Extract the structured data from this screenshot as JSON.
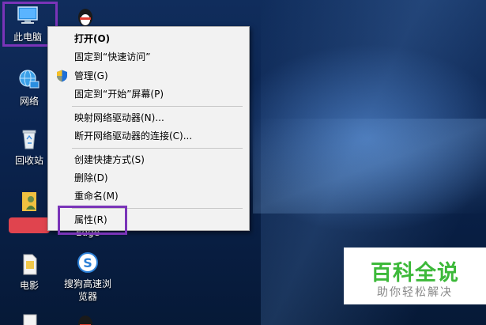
{
  "desktop_icons": [
    {
      "label": "此电脑",
      "icon": "computer-icon"
    },
    {
      "label": "网络",
      "icon": "network-icon"
    },
    {
      "label": "回收站",
      "icon": "recycle-bin-icon"
    },
    {
      "label": "",
      "icon": "user-folder-icon"
    },
    {
      "label": "电影",
      "icon": "file-icon"
    },
    {
      "label": "",
      "icon": "qq-icon"
    },
    {
      "label": "搜狗高速浏览器",
      "icon": "sogou-browser-icon"
    },
    {
      "label": "Edge",
      "icon": "edge-icon"
    }
  ],
  "context_menu": {
    "items": [
      {
        "label": "打开(O)",
        "bold": true
      },
      {
        "label": "固定到“快速访问”"
      },
      {
        "label": "管理(G)",
        "icon": "shield-icon"
      },
      {
        "label": "固定到“开始”屏幕(P)"
      },
      {
        "label": "映射网络驱动器(N)..."
      },
      {
        "label": "断开网络驱动器的连接(C)..."
      },
      {
        "label": "创建快捷方式(S)"
      },
      {
        "label": "删除(D)"
      },
      {
        "label": "重命名(M)"
      },
      {
        "label": "属性(R)"
      }
    ]
  },
  "watermark": {
    "title": "百科全说",
    "subtitle": "助你轻松解决"
  },
  "colors": {
    "highlight": "#7a34b8",
    "watermark_green": "#3db93a",
    "redaction": "#e0444e"
  }
}
